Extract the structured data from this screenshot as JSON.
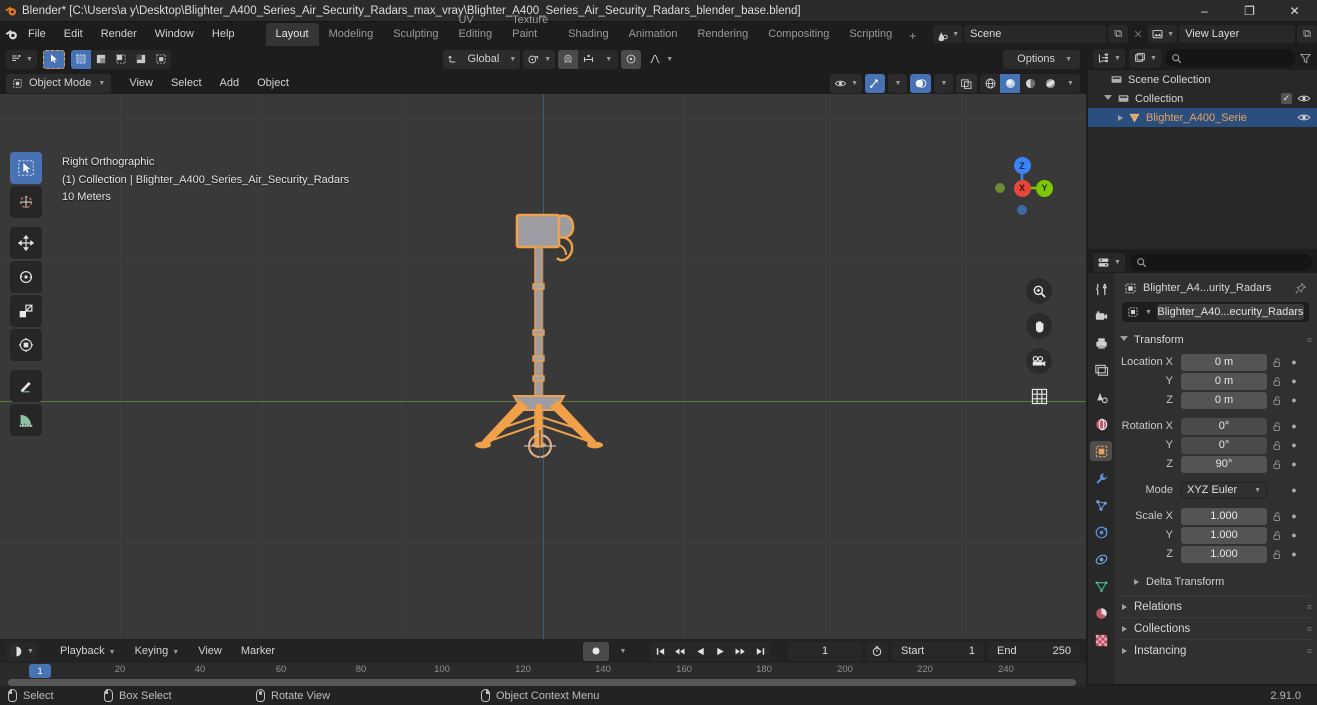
{
  "window": {
    "title": "Blender* [C:\\Users\\a y\\Desktop\\Blighter_A400_Series_Air_Security_Radars_max_vray\\Blighter_A400_Series_Air_Security_Radars_blender_base.blend]",
    "minimize": "–",
    "maximize": "❐",
    "close": "✕"
  },
  "menu": {
    "items": [
      "File",
      "Edit",
      "Render",
      "Window",
      "Help"
    ]
  },
  "workspaces": {
    "tabs": [
      "Layout",
      "Modeling",
      "Sculpting",
      "UV Editing",
      "Texture Paint",
      "Shading",
      "Animation",
      "Rendering",
      "Compositing",
      "Scripting"
    ],
    "active": "Layout",
    "add": "+"
  },
  "scene_selector": {
    "scene_label": "Scene",
    "view_layer_label": "View Layer",
    "copy": "⧉",
    "close": "✕"
  },
  "viewport_header": {
    "mode": "Object Mode",
    "menus": [
      "View",
      "Select",
      "Add",
      "Object"
    ],
    "transform_orientation": "Global",
    "options": "Options",
    "snap_icon": "magnet-icon",
    "proportional_icon": "proportional-edit-icon",
    "pivot_icon": "pivot-point-icon"
  },
  "viewport_overlay": {
    "view_name": "Right Orthographic",
    "collection_object": "(1) Collection | Blighter_A400_Series_Air_Security_Radars",
    "grid_scale": "10 Meters"
  },
  "gizmo": {
    "axes": [
      {
        "label": "Z",
        "color": "#3b82f6"
      },
      {
        "label": "X",
        "color": "#e8453c"
      },
      {
        "label": "Y",
        "color": "#7dc800"
      }
    ],
    "neg_y_color": "#6b8a33",
    "neg_z_color": "#3a6ba5"
  },
  "nav_buttons": [
    "zoom-icon",
    "pan-hand-icon",
    "camera-icon",
    "grid-ortho-icon"
  ],
  "toolbar": {
    "tools": [
      {
        "name": "tweak-select-tool",
        "active": true
      },
      {
        "name": "cursor-tool",
        "active": false
      },
      {
        "name": "move-tool",
        "active": false
      },
      {
        "name": "rotate-tool",
        "active": false
      },
      {
        "name": "scale-tool",
        "active": false
      },
      {
        "name": "transform-tool",
        "active": false
      },
      {
        "name": "annotate-tool",
        "active": false
      },
      {
        "name": "measure-tool",
        "active": false
      }
    ]
  },
  "shading": {
    "modes": [
      "wireframe",
      "solid",
      "material-preview",
      "rendered"
    ],
    "active": "solid"
  },
  "timeline": {
    "editor_icon": "timeline-icon",
    "menus": [
      "Playback",
      "Keying",
      "View",
      "Marker"
    ],
    "current_frame": "1",
    "start_label": "Start",
    "start_value": "1",
    "end_label": "End",
    "end_value": "250",
    "ticks": [
      "20",
      "40",
      "60",
      "80",
      "100",
      "120",
      "140",
      "160",
      "180",
      "200",
      "220",
      "240"
    ],
    "playhead_label": "1",
    "transport": [
      "jump-start-icon",
      "prev-keyframe-icon",
      "play-reverse-icon",
      "play-icon",
      "next-keyframe-icon",
      "jump-end-icon"
    ],
    "record_icon": "record-icon"
  },
  "outliner": {
    "display_mode_icon": "outliner-icon",
    "filter_icon": "filter-icon",
    "search_placeholder": "",
    "rows": [
      {
        "label": "Scene Collection",
        "icon": "collection-icon",
        "indent": 0,
        "selected": false,
        "expand": "none",
        "checkbox": false,
        "eye": false
      },
      {
        "label": "Collection",
        "icon": "collection-icon",
        "indent": 1,
        "selected": false,
        "expand": "down",
        "checkbox": true,
        "eye": true
      },
      {
        "label": "Blighter_A400_Serie",
        "icon": "mesh-object-icon",
        "indent": 2,
        "selected": true,
        "expand": "right",
        "checkbox": false,
        "eye": true
      }
    ]
  },
  "properties": {
    "editor_icon": "properties-icon",
    "search_placeholder": "",
    "tabs": [
      {
        "name": "tool-tab",
        "icon": "tool-icon",
        "active": false
      },
      {
        "name": "render-tab",
        "icon": "render-camera-icon",
        "active": false
      },
      {
        "name": "output-tab",
        "icon": "printer-icon",
        "active": false
      },
      {
        "name": "view-layer-tab",
        "icon": "images-icon",
        "active": false
      },
      {
        "name": "scene-tab",
        "icon": "scene-cone-icon",
        "active": false
      },
      {
        "name": "world-tab",
        "icon": "world-globe-icon",
        "active": false
      },
      {
        "name": "object-tab",
        "icon": "object-square-icon",
        "active": true
      },
      {
        "name": "modifier-tab",
        "icon": "wrench-icon",
        "active": false
      },
      {
        "name": "particles-tab",
        "icon": "particles-icon",
        "active": false
      },
      {
        "name": "physics-tab",
        "icon": "physics-orbit-icon",
        "active": false
      },
      {
        "name": "constraints-tab",
        "icon": "constraint-icon",
        "active": false
      },
      {
        "name": "data-tab",
        "icon": "mesh-data-triangle-icon",
        "active": false
      },
      {
        "name": "material-tab",
        "icon": "material-sphere-icon",
        "active": false
      },
      {
        "name": "texture-tab",
        "icon": "texture-checker-icon",
        "active": false
      }
    ],
    "breadcrumb": "Blighter_A4...urity_Radars",
    "pin_icon": "pin-icon",
    "object_name": "Blighter_A40...ecurity_Radars",
    "transform_panel": "Transform",
    "fields": [
      {
        "label": "Location X",
        "value": "0 m"
      },
      {
        "label": "Y",
        "value": "0 m"
      },
      {
        "label": "Z",
        "value": "0 m"
      },
      {
        "label": "Rotation X",
        "value": "0°"
      },
      {
        "label": "Y",
        "value": "0°"
      },
      {
        "label": "Z",
        "value": "90°"
      }
    ],
    "mode_label": "Mode",
    "mode_value": "XYZ Euler",
    "scale_fields": [
      {
        "label": "Scale X",
        "value": "1.000"
      },
      {
        "label": "Y",
        "value": "1.000"
      },
      {
        "label": "Z",
        "value": "1.000"
      }
    ],
    "sub_panels": [
      "Delta Transform"
    ],
    "panels": [
      "Relations",
      "Collections",
      "Instancing"
    ]
  },
  "statusbar": {
    "items": [
      {
        "label": "Select",
        "mouse": "left"
      },
      {
        "label": "Box Select",
        "mouse": "left-drag"
      },
      {
        "label": "Rotate View",
        "mouse": "middle"
      },
      {
        "label": "Object Context Menu",
        "mouse": "right"
      }
    ],
    "version": "2.91.0"
  },
  "colors": {
    "accent": "#4772b3",
    "selection_orange": "#ed9e5c",
    "background": "#393939"
  }
}
